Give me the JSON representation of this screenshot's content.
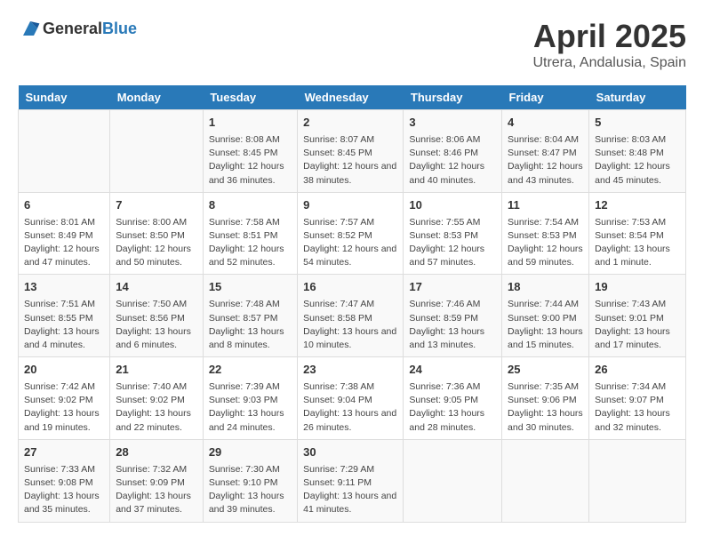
{
  "logo": {
    "general": "General",
    "blue": "Blue"
  },
  "title": "April 2025",
  "subtitle": "Utrera, Andalusia, Spain",
  "weekdays": [
    "Sunday",
    "Monday",
    "Tuesday",
    "Wednesday",
    "Thursday",
    "Friday",
    "Saturday"
  ],
  "weeks": [
    [
      {
        "day": "",
        "content": ""
      },
      {
        "day": "",
        "content": ""
      },
      {
        "day": "1",
        "content": "Sunrise: 8:08 AM\nSunset: 8:45 PM\nDaylight: 12 hours and 36 minutes."
      },
      {
        "day": "2",
        "content": "Sunrise: 8:07 AM\nSunset: 8:45 PM\nDaylight: 12 hours and 38 minutes."
      },
      {
        "day": "3",
        "content": "Sunrise: 8:06 AM\nSunset: 8:46 PM\nDaylight: 12 hours and 40 minutes."
      },
      {
        "day": "4",
        "content": "Sunrise: 8:04 AM\nSunset: 8:47 PM\nDaylight: 12 hours and 43 minutes."
      },
      {
        "day": "5",
        "content": "Sunrise: 8:03 AM\nSunset: 8:48 PM\nDaylight: 12 hours and 45 minutes."
      }
    ],
    [
      {
        "day": "6",
        "content": "Sunrise: 8:01 AM\nSunset: 8:49 PM\nDaylight: 12 hours and 47 minutes."
      },
      {
        "day": "7",
        "content": "Sunrise: 8:00 AM\nSunset: 8:50 PM\nDaylight: 12 hours and 50 minutes."
      },
      {
        "day": "8",
        "content": "Sunrise: 7:58 AM\nSunset: 8:51 PM\nDaylight: 12 hours and 52 minutes."
      },
      {
        "day": "9",
        "content": "Sunrise: 7:57 AM\nSunset: 8:52 PM\nDaylight: 12 hours and 54 minutes."
      },
      {
        "day": "10",
        "content": "Sunrise: 7:55 AM\nSunset: 8:53 PM\nDaylight: 12 hours and 57 minutes."
      },
      {
        "day": "11",
        "content": "Sunrise: 7:54 AM\nSunset: 8:53 PM\nDaylight: 12 hours and 59 minutes."
      },
      {
        "day": "12",
        "content": "Sunrise: 7:53 AM\nSunset: 8:54 PM\nDaylight: 13 hours and 1 minute."
      }
    ],
    [
      {
        "day": "13",
        "content": "Sunrise: 7:51 AM\nSunset: 8:55 PM\nDaylight: 13 hours and 4 minutes."
      },
      {
        "day": "14",
        "content": "Sunrise: 7:50 AM\nSunset: 8:56 PM\nDaylight: 13 hours and 6 minutes."
      },
      {
        "day": "15",
        "content": "Sunrise: 7:48 AM\nSunset: 8:57 PM\nDaylight: 13 hours and 8 minutes."
      },
      {
        "day": "16",
        "content": "Sunrise: 7:47 AM\nSunset: 8:58 PM\nDaylight: 13 hours and 10 minutes."
      },
      {
        "day": "17",
        "content": "Sunrise: 7:46 AM\nSunset: 8:59 PM\nDaylight: 13 hours and 13 minutes."
      },
      {
        "day": "18",
        "content": "Sunrise: 7:44 AM\nSunset: 9:00 PM\nDaylight: 13 hours and 15 minutes."
      },
      {
        "day": "19",
        "content": "Sunrise: 7:43 AM\nSunset: 9:01 PM\nDaylight: 13 hours and 17 minutes."
      }
    ],
    [
      {
        "day": "20",
        "content": "Sunrise: 7:42 AM\nSunset: 9:02 PM\nDaylight: 13 hours and 19 minutes."
      },
      {
        "day": "21",
        "content": "Sunrise: 7:40 AM\nSunset: 9:02 PM\nDaylight: 13 hours and 22 minutes."
      },
      {
        "day": "22",
        "content": "Sunrise: 7:39 AM\nSunset: 9:03 PM\nDaylight: 13 hours and 24 minutes."
      },
      {
        "day": "23",
        "content": "Sunrise: 7:38 AM\nSunset: 9:04 PM\nDaylight: 13 hours and 26 minutes."
      },
      {
        "day": "24",
        "content": "Sunrise: 7:36 AM\nSunset: 9:05 PM\nDaylight: 13 hours and 28 minutes."
      },
      {
        "day": "25",
        "content": "Sunrise: 7:35 AM\nSunset: 9:06 PM\nDaylight: 13 hours and 30 minutes."
      },
      {
        "day": "26",
        "content": "Sunrise: 7:34 AM\nSunset: 9:07 PM\nDaylight: 13 hours and 32 minutes."
      }
    ],
    [
      {
        "day": "27",
        "content": "Sunrise: 7:33 AM\nSunset: 9:08 PM\nDaylight: 13 hours and 35 minutes."
      },
      {
        "day": "28",
        "content": "Sunrise: 7:32 AM\nSunset: 9:09 PM\nDaylight: 13 hours and 37 minutes."
      },
      {
        "day": "29",
        "content": "Sunrise: 7:30 AM\nSunset: 9:10 PM\nDaylight: 13 hours and 39 minutes."
      },
      {
        "day": "30",
        "content": "Sunrise: 7:29 AM\nSunset: 9:11 PM\nDaylight: 13 hours and 41 minutes."
      },
      {
        "day": "",
        "content": ""
      },
      {
        "day": "",
        "content": ""
      },
      {
        "day": "",
        "content": ""
      }
    ]
  ]
}
